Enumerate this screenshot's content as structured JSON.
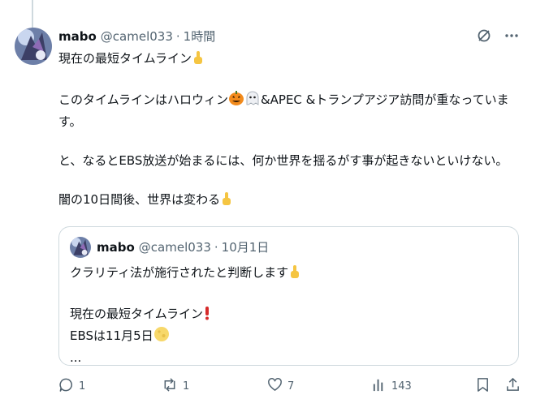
{
  "post": {
    "author_name": "mabo",
    "handle": "@camel033",
    "separator": "·",
    "time": "1時間",
    "paragraphs": [
      "現在の最短タイムライン",
      "このタイムラインはハロウィン",
      "&APEC &トランプアジア訪問が重なっています。",
      "と、なるとEBS放送が始まるには、何か世界を揺るがす事が起きないといけない。",
      "闇の10日間後、世界は変わる"
    ]
  },
  "quoted": {
    "author_name": "mabo",
    "handle": "@camel033",
    "separator": "·",
    "date": "10月1日",
    "line1": "クラリティ法が施行されたと判断します",
    "line2": "現在の最短タイムライン",
    "line3": "EBSは11月5日",
    "line4": "..."
  },
  "actions": {
    "reply_count": "1",
    "repost_count": "1",
    "like_count": "7",
    "view_count": "143"
  },
  "icons": {
    "grok": "grok-icon",
    "more": "more-icon",
    "reply": "reply-icon",
    "repost": "repost-icon",
    "like": "heart-icon",
    "views": "views-icon",
    "bookmark": "bookmark-icon",
    "share": "share-icon"
  },
  "colors": {
    "text": "#0f1419",
    "muted": "#536471",
    "border": "#cfd9de"
  }
}
